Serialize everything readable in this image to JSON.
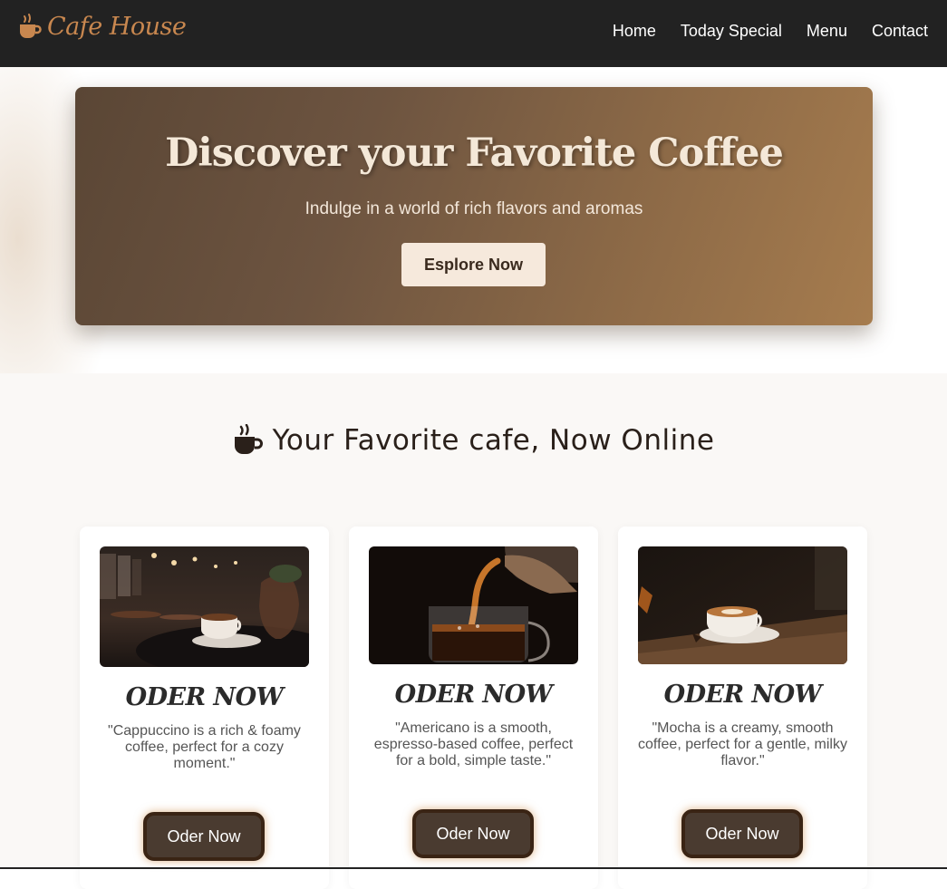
{
  "navbar": {
    "brand": "Cafe House",
    "links": [
      {
        "label": "Home"
      },
      {
        "label": "Today Special"
      },
      {
        "label": "Menu"
      },
      {
        "label": "Contact"
      }
    ]
  },
  "hero": {
    "title": "Discover your Favorite Coffee",
    "subtitle": "Indulge in a world of rich flavors and aromas",
    "button_label": "Esplore Now"
  },
  "section": {
    "title": "Your Favorite cafe, Now Online",
    "cards": [
      {
        "title": "ODER NOW",
        "description": "\"Cappuccino is a rich & foamy coffee, perfect for a cozy moment.\"",
        "button_label": "Oder Now"
      },
      {
        "title": "ODER NOW",
        "description": "\"Americano is a smooth, espresso-based coffee, perfect for a bold, simple taste.\"",
        "button_label": "Oder Now"
      },
      {
        "title": "ODER NOW",
        "description": "\"Mocha is a creamy, smooth coffee, perfect for a gentle, milky flavor.\"",
        "button_label": "Oder Now"
      }
    ]
  },
  "colors": {
    "navbar_bg": "#222222",
    "brand": "#c8874f",
    "hero_start": "#5a4635",
    "hero_end": "#a67c4e",
    "button_dark": "#4a3b30"
  },
  "icons": {
    "brand": "coffee-cup-icon",
    "section": "coffee-cup-icon"
  }
}
